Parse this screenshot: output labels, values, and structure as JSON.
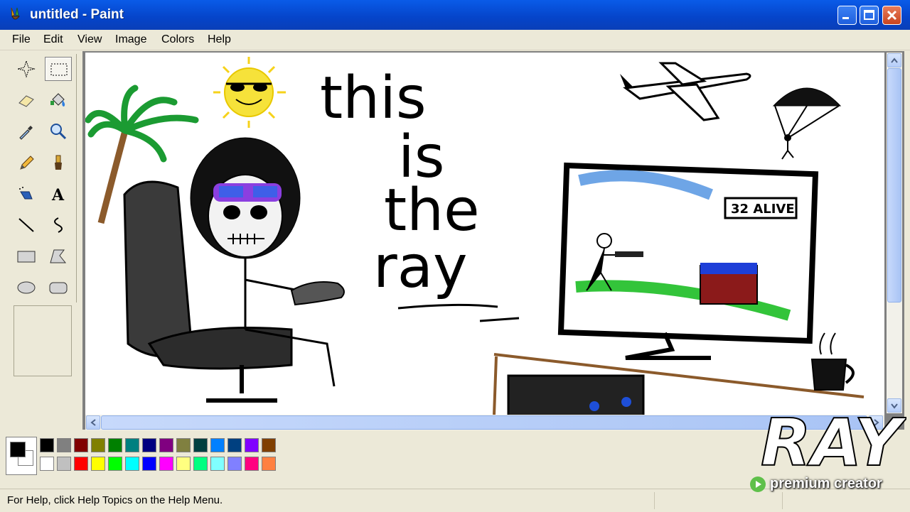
{
  "window": {
    "title": "untitled - Paint",
    "icon": "paint-brush-icon",
    "controls": [
      "minimize-icon",
      "maximize-icon",
      "close-icon"
    ]
  },
  "menu": [
    "File",
    "Edit",
    "View",
    "Image",
    "Colors",
    "Help"
  ],
  "tools": [
    {
      "name": "free-form-select",
      "icon": "star-select-icon"
    },
    {
      "name": "select",
      "icon": "rect-select-icon",
      "active": true
    },
    {
      "name": "eraser",
      "icon": "eraser-icon"
    },
    {
      "name": "fill",
      "icon": "paint-bucket-icon"
    },
    {
      "name": "pick-color",
      "icon": "eyedropper-icon"
    },
    {
      "name": "magnifier",
      "icon": "magnifier-icon"
    },
    {
      "name": "pencil",
      "icon": "pencil-icon"
    },
    {
      "name": "brush",
      "icon": "brush-icon"
    },
    {
      "name": "airbrush",
      "icon": "airbrush-icon"
    },
    {
      "name": "text",
      "icon": "text-icon",
      "glyph": "A"
    },
    {
      "name": "line",
      "icon": "line-icon"
    },
    {
      "name": "curve",
      "icon": "curve-icon"
    },
    {
      "name": "rectangle",
      "icon": "rectangle-icon"
    },
    {
      "name": "polygon",
      "icon": "polygon-icon"
    },
    {
      "name": "ellipse",
      "icon": "ellipse-icon"
    },
    {
      "name": "rounded-rectangle",
      "icon": "rounded-rectangle-icon"
    }
  ],
  "canvas": {
    "handwriting": [
      "this",
      "is",
      "the",
      "ray"
    ],
    "monitor_label": "32 ALIVE"
  },
  "palette": {
    "foreground": "#000000",
    "background": "#ffffff",
    "top_row": [
      "#000000",
      "#808080",
      "#800000",
      "#808000",
      "#008000",
      "#008080",
      "#000080",
      "#800080",
      "#808040",
      "#004040",
      "#0080ff",
      "#004080",
      "#8000ff",
      "#804000"
    ],
    "bottom_row": [
      "#ffffff",
      "#c0c0c0",
      "#ff0000",
      "#ffff00",
      "#00ff00",
      "#00ffff",
      "#0000ff",
      "#ff00ff",
      "#ffff80",
      "#00ff80",
      "#80ffff",
      "#8080ff",
      "#ff0080",
      "#ff8040"
    ]
  },
  "status": {
    "help_text": "For Help, click Help Topics on the Help Menu."
  },
  "overlay": {
    "logo_text": "RAY",
    "tagline": "premium creator",
    "tagline_icon": "play-icon"
  }
}
